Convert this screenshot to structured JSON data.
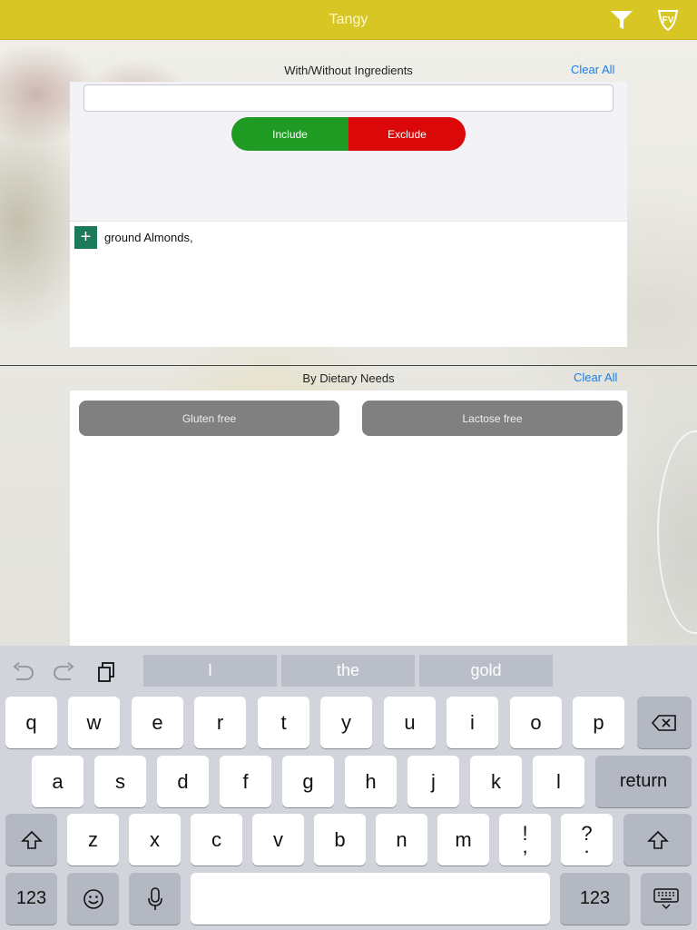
{
  "header": {
    "title": "Tangy",
    "accent_color": "#d8c625",
    "filter_icon": "filter-icon",
    "logo_icon": "logo-icon"
  },
  "ingredients_section": {
    "title": "With/Without Ingredients",
    "clear_all": "Clear All",
    "search_value": "",
    "include_label": "Include",
    "exclude_label": "Exclude",
    "include_color": "#1f9b24",
    "exclude_color": "#da0808",
    "selected_ingredients": "ground Almonds,",
    "add_icon": "plus-icon"
  },
  "dietary_section": {
    "title": "By Dietary Needs",
    "clear_all": "Clear All",
    "options": [
      "Gluten free",
      "Lactose free"
    ]
  },
  "keyboard": {
    "suggestions": [
      "I",
      "the",
      "gold"
    ],
    "row1": [
      "q",
      "w",
      "e",
      "r",
      "t",
      "y",
      "u",
      "i",
      "o",
      "p"
    ],
    "row2": [
      "a",
      "s",
      "d",
      "f",
      "g",
      "h",
      "j",
      "k",
      "l"
    ],
    "return_label": "return",
    "row3": [
      "z",
      "x",
      "c",
      "v",
      "b",
      "n",
      "m"
    ],
    "punct1": [
      "!",
      ","
    ],
    "punct2": [
      "?",
      "."
    ],
    "numbers_label": "123"
  }
}
